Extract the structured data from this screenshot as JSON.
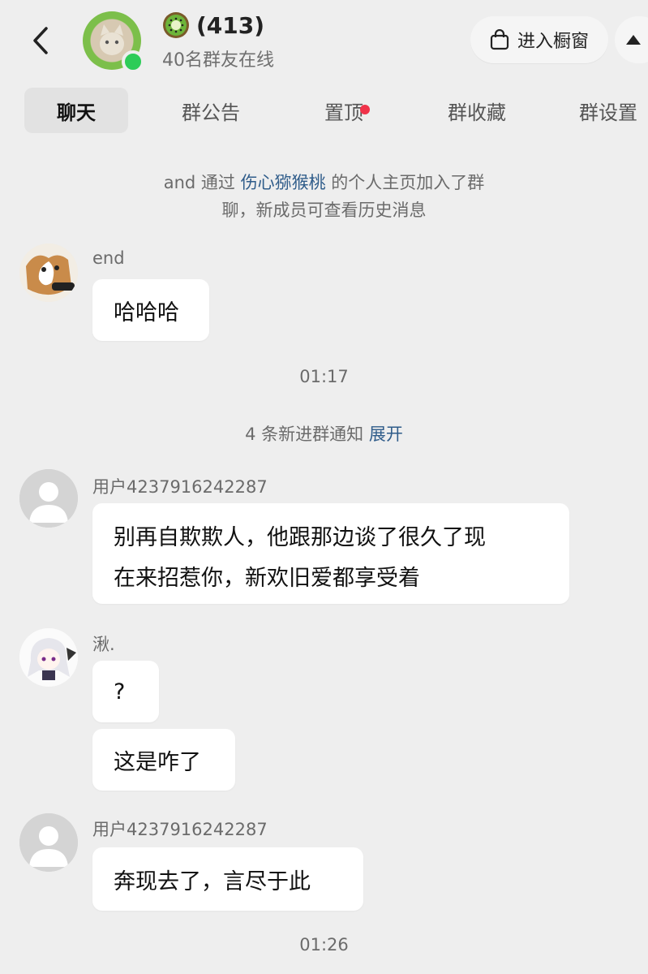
{
  "header": {
    "group_count": "(413)",
    "online_text": "40名群友在线",
    "shop_label": "进入橱窗",
    "group_icon": "kiwi-emoji"
  },
  "tabs": [
    {
      "label": "聊天",
      "active": true
    },
    {
      "label": "群公告"
    },
    {
      "label": "置顶",
      "badge": true
    },
    {
      "label": "群收藏"
    },
    {
      "label": "群设置"
    }
  ],
  "system": {
    "join_part1": "and 通过 ",
    "join_link": "伤心猕猴桃",
    "join_part2": " 的个人主页加入了群",
    "join_line2": "聊，新成员可查看历史消息",
    "notice_text": "4 条新进群通知 ",
    "notice_link": "展开"
  },
  "times": {
    "t1": "01:17",
    "t2": "01:26"
  },
  "messages": [
    {
      "sender": "end",
      "texts": [
        "哈哈哈"
      ]
    },
    {
      "sender": "用户4237916242287",
      "texts": [
        "别再自欺欺人，他跟那边谈了很久了现",
        "在来招惹你，新欢旧爱都享受着"
      ]
    },
    {
      "sender": "湫.",
      "texts": [
        "?",
        "这是咋了"
      ]
    },
    {
      "sender": "用户4237916242287",
      "texts": [
        "奔现去了，言尽于此"
      ]
    }
  ],
  "colors": {
    "background": "#eeeeee",
    "bubble": "#ffffff",
    "link": "#2f5c8a",
    "online": "#2dcc58",
    "badge": "#f0334a"
  }
}
